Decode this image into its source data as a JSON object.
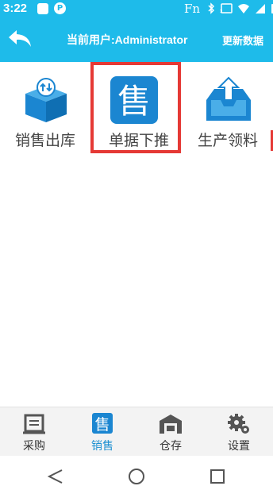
{
  "status": {
    "time": "3:22",
    "fn_label": "Fn"
  },
  "toolbar": {
    "current_user": "当前用户:Administrator",
    "refresh_label": "更新数据"
  },
  "tiles": [
    {
      "label": "销售出库",
      "icon": "box-delivery-icon",
      "selected": false
    },
    {
      "label": "单据下推",
      "icon": "sale-doc-icon",
      "selected": true
    },
    {
      "label": "生产领料",
      "icon": "tray-upload-icon",
      "selected": false
    }
  ],
  "tabs": [
    {
      "label": "采购",
      "icon": "purchase-icon",
      "active": false
    },
    {
      "label": "销售",
      "icon": "sales-icon",
      "active": true
    },
    {
      "label": "仓存",
      "icon": "warehouse-icon",
      "active": false
    },
    {
      "label": "设置",
      "icon": "gear-icon",
      "active": false
    }
  ],
  "colors": {
    "primary": "#1ebbea",
    "selection": "#e53935",
    "tab_active": "#1a8fd1"
  }
}
